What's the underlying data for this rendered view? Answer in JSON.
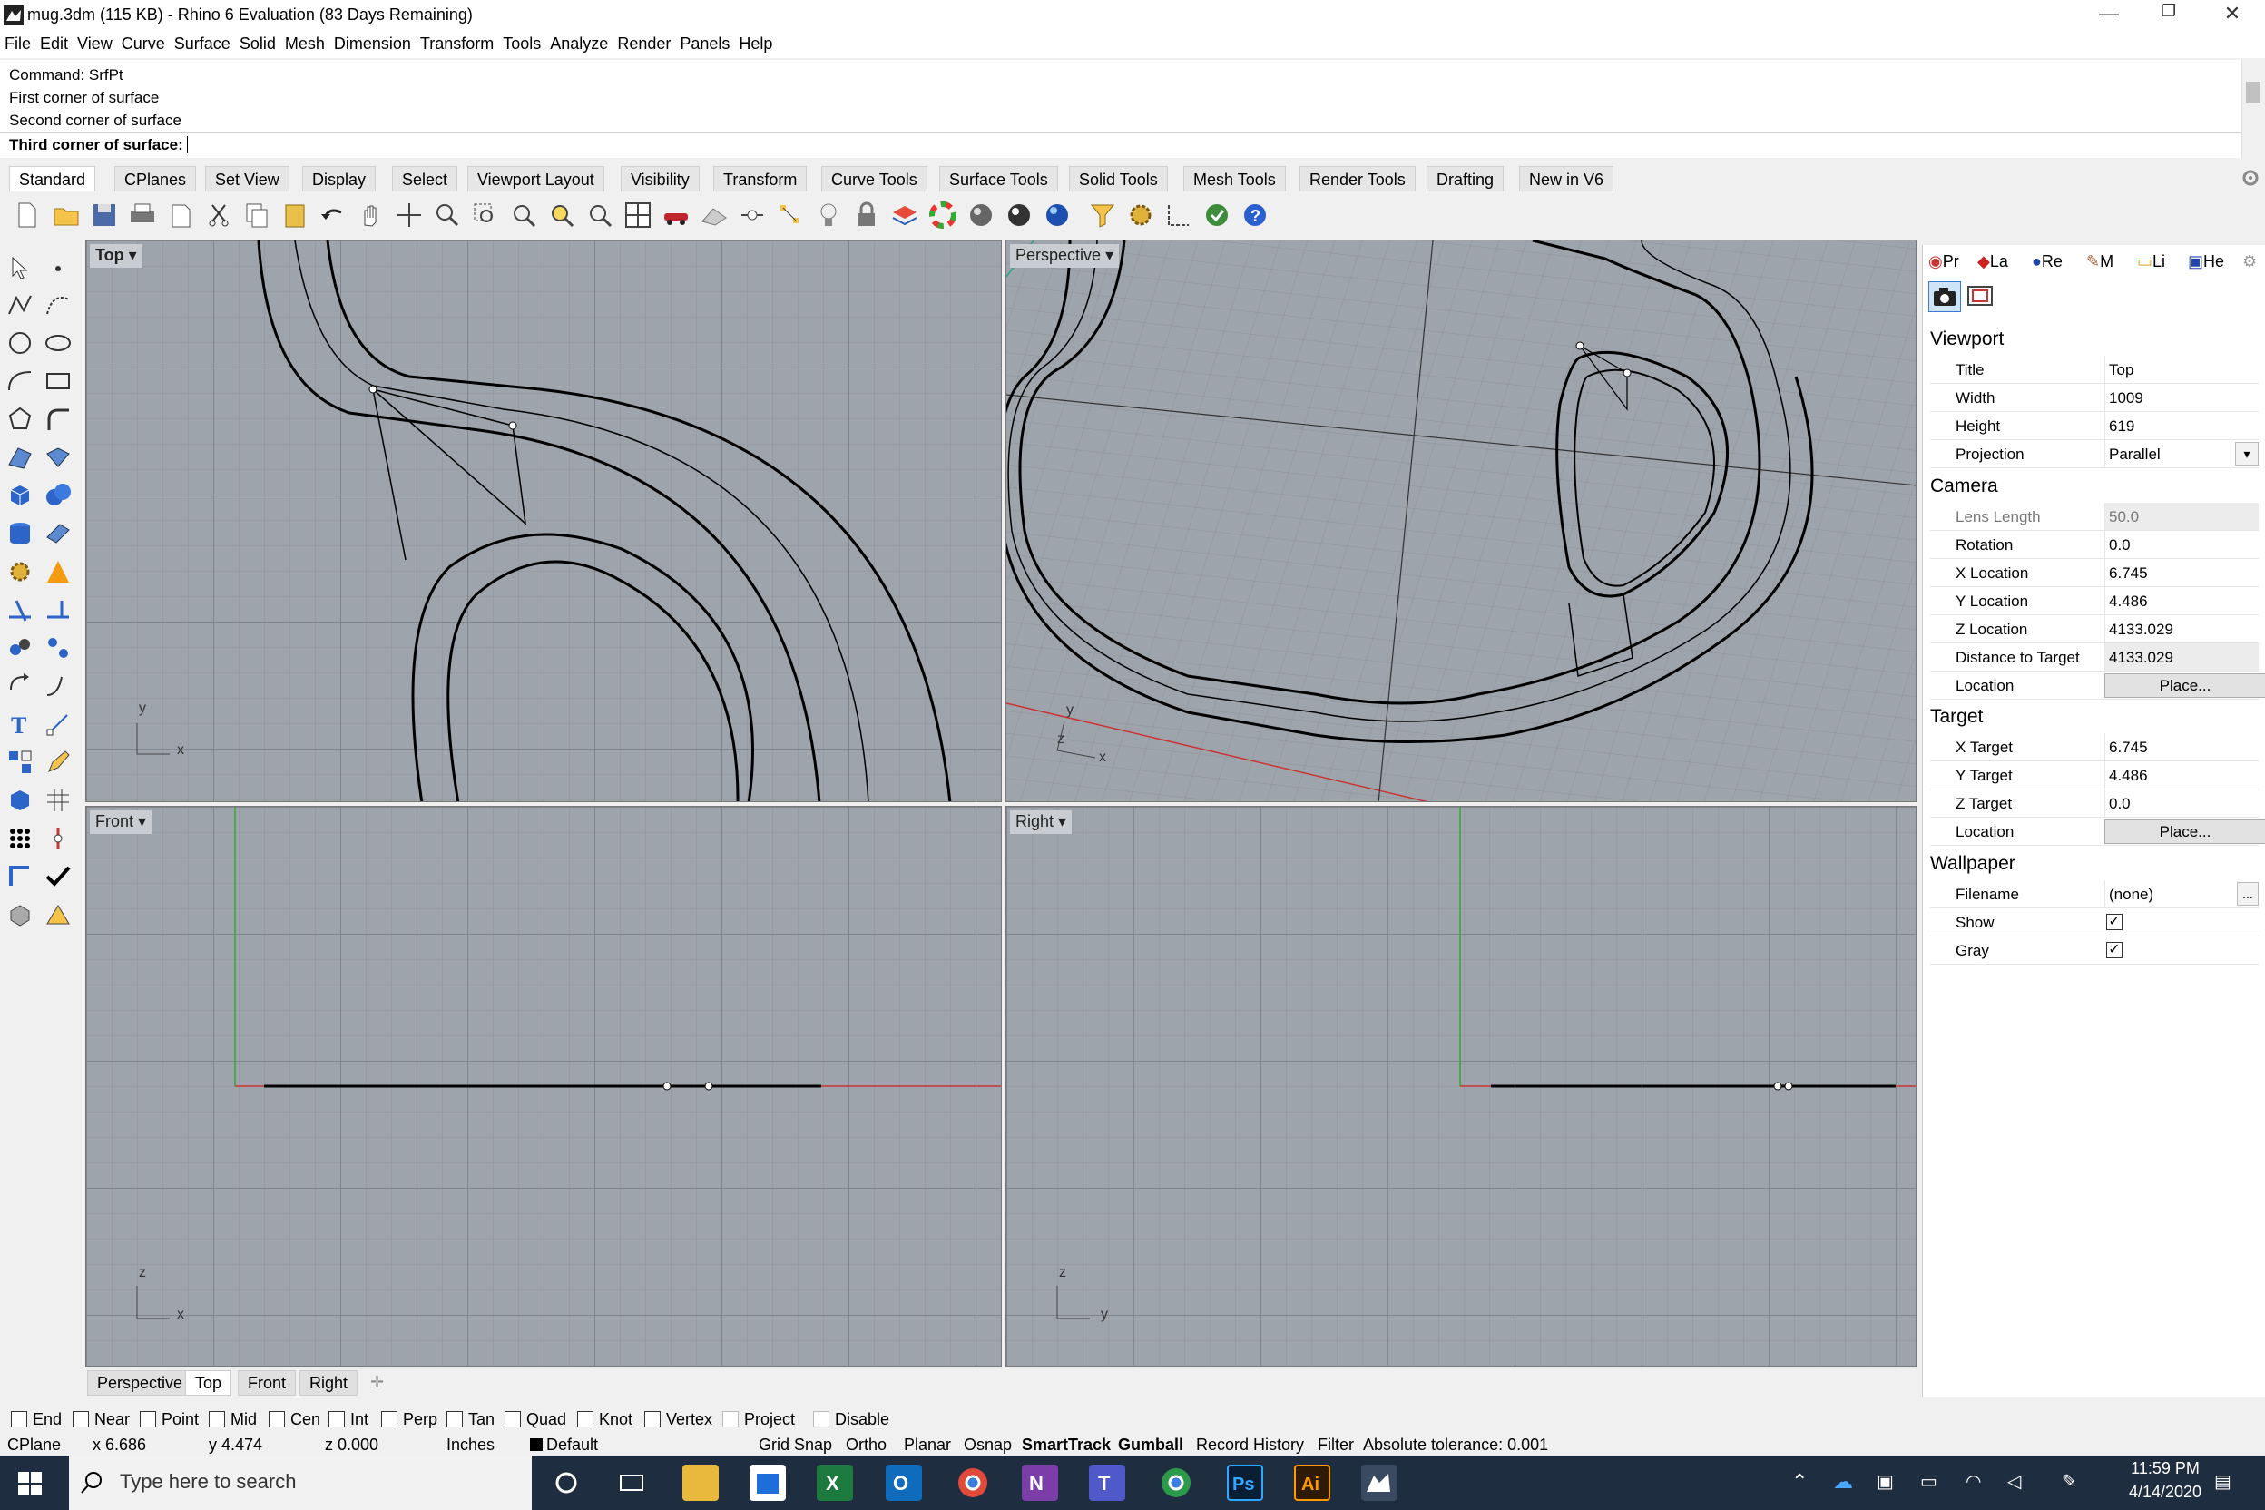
{
  "window": {
    "title": "mug.3dm (115 KB) - Rhino 6 Evaluation (83 Days Remaining)",
    "controls": [
      "—",
      "❐",
      "✕"
    ]
  },
  "menu": [
    "File",
    "Edit",
    "View",
    "Curve",
    "Surface",
    "Solid",
    "Mesh",
    "Dimension",
    "Transform",
    "Tools",
    "Analyze",
    "Render",
    "Panels",
    "Help"
  ],
  "command": {
    "history": [
      "Command: SrfPt",
      "First corner of surface",
      "Second corner of surface"
    ],
    "prompt": "Third corner of surface:"
  },
  "tabs": [
    "Standard",
    "CPlanes",
    "Set View",
    "Display",
    "Select",
    "Viewport Layout",
    "Visibility",
    "Transform",
    "Curve Tools",
    "Surface Tools",
    "Solid Tools",
    "Mesh Tools",
    "Render Tools",
    "Drafting",
    "New in V6"
  ],
  "viewports": {
    "top": {
      "label": "Top",
      "axes": [
        "y",
        "x"
      ]
    },
    "perspective": {
      "label": "Perspective",
      "axes": [
        "y",
        "z",
        "x"
      ]
    },
    "front": {
      "label": "Front",
      "axes": [
        "z",
        "x"
      ]
    },
    "right": {
      "label": "Right",
      "axes": [
        "z",
        "y"
      ]
    }
  },
  "viewport_tabs": [
    "Perspective",
    "Top",
    "Front",
    "Right"
  ],
  "panel": {
    "tabs": [
      "Pr",
      "La",
      "Re",
      "M",
      "Li",
      "He"
    ],
    "viewport_section": "Viewport",
    "viewport_rows": [
      {
        "k": "Title",
        "v": "Top"
      },
      {
        "k": "Width",
        "v": "1009"
      },
      {
        "k": "Height",
        "v": "619"
      },
      {
        "k": "Projection",
        "v": "Parallel"
      }
    ],
    "camera_section": "Camera",
    "camera_rows": [
      {
        "k": "Lens Length",
        "v": "50.0"
      },
      {
        "k": "Rotation",
        "v": "0.0"
      },
      {
        "k": "X Location",
        "v": "6.745"
      },
      {
        "k": "Y Location",
        "v": "4.486"
      },
      {
        "k": "Z Location",
        "v": "4133.029"
      },
      {
        "k": "Distance to Target",
        "v": "4133.029"
      },
      {
        "k": "Location",
        "v": "Place..."
      }
    ],
    "target_section": "Target",
    "target_rows": [
      {
        "k": "X Target",
        "v": "6.745"
      },
      {
        "k": "Y Target",
        "v": "4.486"
      },
      {
        "k": "Z Target",
        "v": "0.0"
      },
      {
        "k": "Location",
        "v": "Place..."
      }
    ],
    "wallpaper_section": "Wallpaper",
    "wallpaper_rows": [
      {
        "k": "Filename",
        "v": "(none)"
      },
      {
        "k": "Show",
        "v": "✓"
      },
      {
        "k": "Gray",
        "v": "✓"
      }
    ],
    "more_button": "..."
  },
  "osnaps": [
    "End",
    "Near",
    "Point",
    "Mid",
    "Cen",
    "Int",
    "Perp",
    "Tan",
    "Quad",
    "Knot",
    "Vertex",
    "Project",
    "Disable"
  ],
  "status": {
    "cplane": "CPlane",
    "x": "x 6.686",
    "y": "y 4.474",
    "z": "z 0.000",
    "units": "Inches",
    "layer": "Default",
    "grid_snap": "Grid Snap",
    "ortho": "Ortho",
    "planar": "Planar",
    "osnap": "Osnap",
    "smarttrack": "SmartTrack",
    "gumball": "Gumball",
    "record_history": "Record History",
    "filter": "Filter",
    "tolerance": "Absolute tolerance: 0.001"
  },
  "taskbar": {
    "search_placeholder": "Type here to search",
    "time": "11:59 PM",
    "date": "4/14/2020",
    "apps": [
      "task-view",
      "file-explorer",
      "store",
      "excel",
      "outlook",
      "chrome",
      "onenote",
      "teams",
      "chrome-2",
      "photoshop",
      "illustrator",
      "rhino"
    ]
  }
}
